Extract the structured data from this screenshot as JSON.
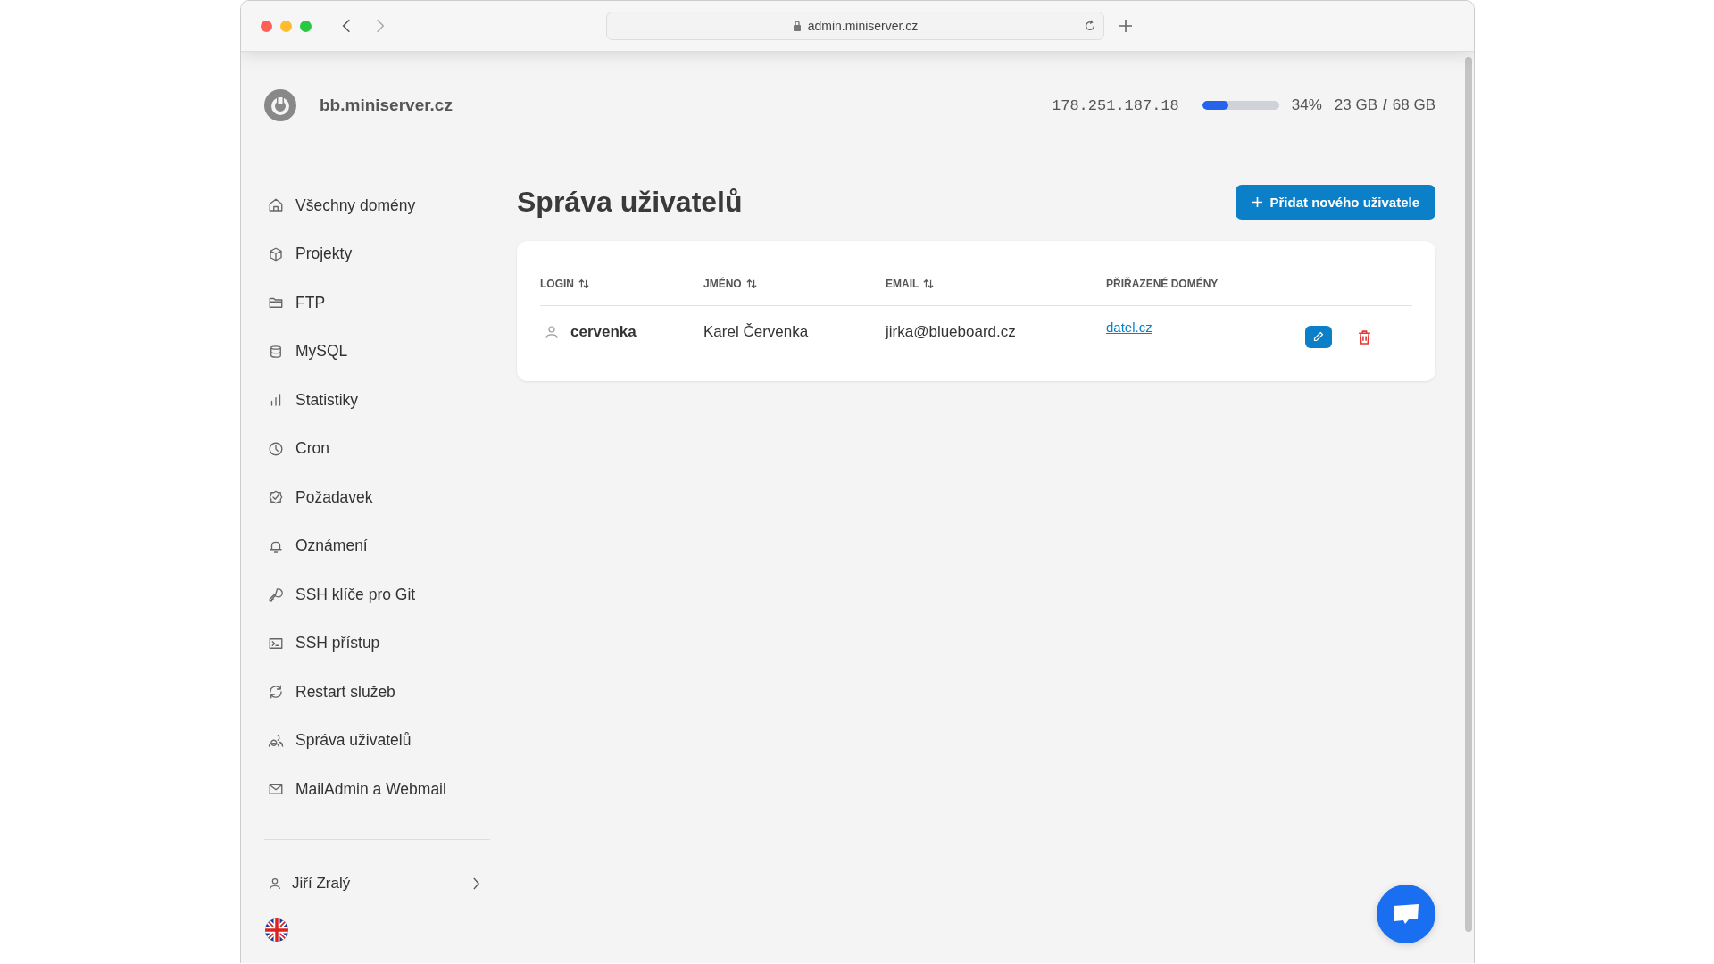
{
  "browser": {
    "url": "admin.miniserver.cz"
  },
  "header": {
    "server": "bb.miniserver.cz",
    "ip": "178.251.187.18",
    "usage": {
      "level": 0.34,
      "percent": "34%",
      "used": "23 GB",
      "separator": "/",
      "total": "68 GB"
    }
  },
  "sidebar": {
    "items": [
      {
        "label": "Všechny domény"
      },
      {
        "label": "Projekty"
      },
      {
        "label": "FTP"
      },
      {
        "label": "MySQL"
      },
      {
        "label": "Statistiky"
      },
      {
        "label": "Cron"
      },
      {
        "label": "Požadavek"
      },
      {
        "label": "Oznámení"
      },
      {
        "label": "SSH klíče pro Git"
      },
      {
        "label": "SSH přístup"
      },
      {
        "label": "Restart služeb"
      },
      {
        "label": "Správa uživatelů"
      },
      {
        "label": "MailAdmin a Webmail"
      }
    ],
    "user": {
      "name": "Jiří Zralý"
    }
  },
  "page": {
    "title": "Správa uživatelů",
    "add_button": "Přidat nového uživatele"
  },
  "table": {
    "columns": [
      {
        "label": "LOGIN",
        "sortable": true
      },
      {
        "label": "JMÉNO",
        "sortable": true
      },
      {
        "label": "EMAIL",
        "sortable": true
      },
      {
        "label": "PŘIŘAZENÉ DOMÉNY",
        "sortable": false
      }
    ],
    "rows": [
      {
        "login": "cervenka",
        "name": "Karel Červenka",
        "email": "jirka@blueboard.cz",
        "domains": [
          "datel.cz"
        ]
      }
    ]
  }
}
